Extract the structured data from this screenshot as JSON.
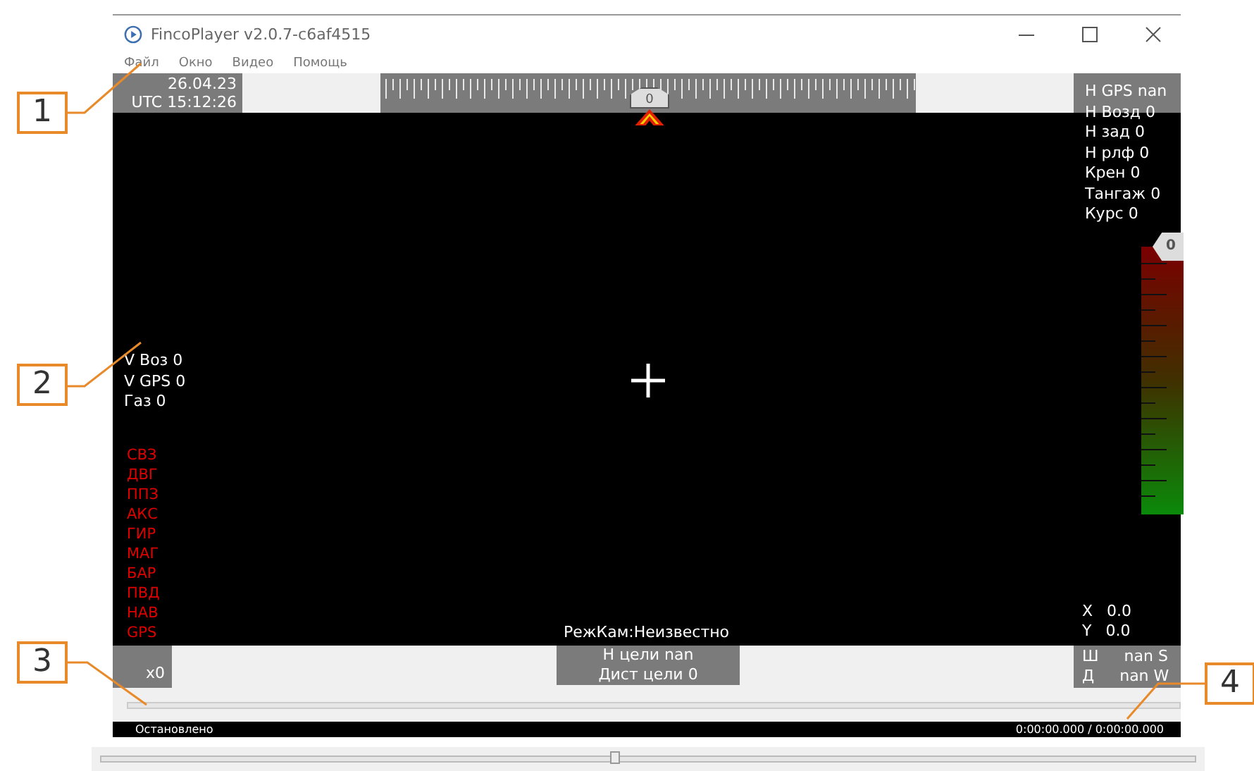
{
  "window": {
    "title": "FincoPlayer v2.0.7-c6af4515"
  },
  "menu": [
    "Файл",
    "Окно",
    "Видео",
    "Помощь"
  ],
  "hud": {
    "date": "26.04.23",
    "time": "UTC 15:12:26",
    "heading_marker": "0",
    "altitude_marker": "0",
    "right_readouts": [
      "H GPS nan",
      "H Возд 0",
      "H зад 0",
      "H рлф 0",
      "Крен 0",
      "Тангаж 0",
      "Курс 0"
    ],
    "left_readouts": [
      "V Воз 0",
      "V GPS 0",
      "Газ 0"
    ],
    "status_flags": [
      "СВЗ",
      "ДВГ",
      "ППЗ",
      "АКС",
      "ГИР",
      "МАГ",
      "БАР",
      "ПВД",
      "НАВ",
      "GPS"
    ],
    "zoom": "x0",
    "camera_mode": "РежКам:Неизвестно",
    "target": [
      "Н цели nan",
      "Дист цели 0"
    ],
    "xy": [
      {
        "label": "X",
        "value": "0.0"
      },
      {
        "label": "Y",
        "value": "0.0"
      }
    ],
    "geo": [
      {
        "label": "Ш",
        "value": "nan S"
      },
      {
        "label": "Д",
        "value": "nan W"
      }
    ]
  },
  "player": {
    "status": "Остановлено",
    "time": "0:00:00.000 / 0:00:00.000"
  },
  "seek_slider": {
    "level": 0.47
  },
  "callouts": [
    "1",
    "2",
    "3",
    "4"
  ]
}
